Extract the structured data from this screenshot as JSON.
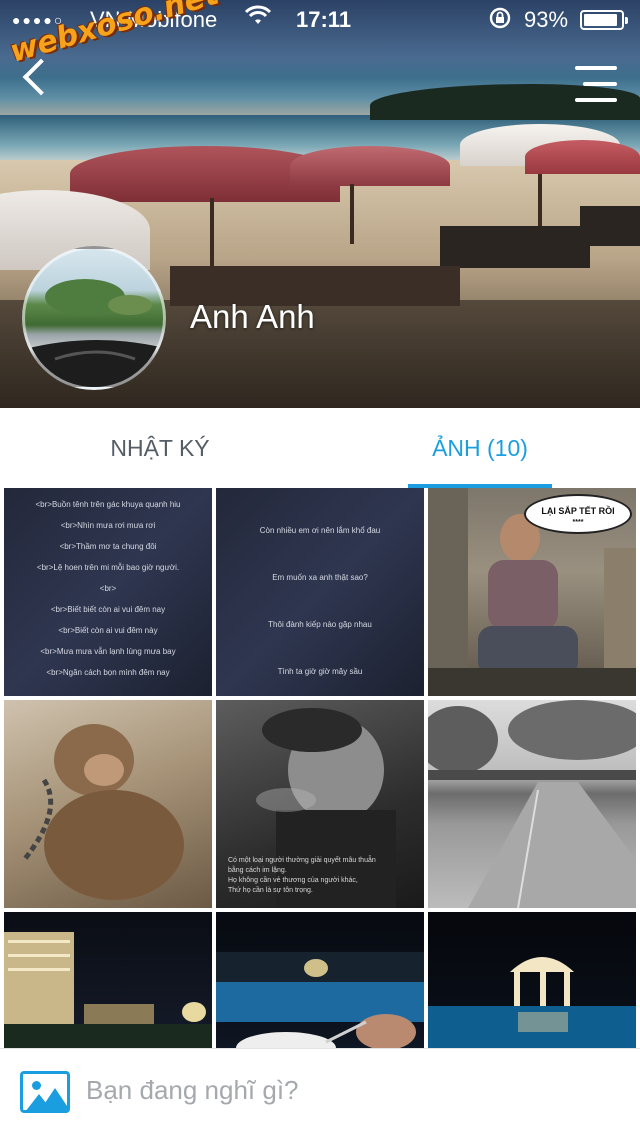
{
  "status_bar": {
    "signal_dots": "●●●●○",
    "carrier": "VN Mobifone",
    "time": "17:11",
    "battery_percent": "93%",
    "battery_level": 0.93,
    "wifi_icon": "wifi-icon",
    "rotation_lock_icon": "rotation-lock-icon"
  },
  "watermark": "webxoso.net",
  "profile": {
    "name": "Anh Anh"
  },
  "tabs": [
    {
      "label": "NHẬT KÝ",
      "active": false
    },
    {
      "label": "ẢNH (10)",
      "active": true
    }
  ],
  "photos": {
    "poem1_lines": [
      "<br>Buồn tênh trên gác khuya quạnh hiu",
      "<br>Nhìn mưa rơi mưa rơi",
      "<br>Thầm mơ ta chung đôi",
      "<br>Lệ hoen trên mi mỗi bao giờ người.",
      "<br>",
      "<br>Biết biết còn ai vui đêm nay",
      "<br>Biết còn ai vui đêm này",
      "<br>Mưa mưa vẫn lạnh lùng mưa bay",
      "<br>Ngăn cách bọn mình đêm nay"
    ],
    "poem2_lines": [
      "Còn nhiều em ơi nên lắm khổ đau",
      "Em muốn xa anh thật sao?",
      "Thôi đành kiếp nào gặp nhau",
      "Tình ta giờ giờ mây sầu"
    ],
    "speech_bubble": "LẠI SẮP TẾT RỒI",
    "speech_bubble_sub": "****",
    "quote_lines": [
      "Có một loại người thường giải quyết mâu thuẫn",
      "bằng cách im lặng.",
      "Họ không cần vẻ thương của người khác,",
      "Thứ họ cần là sự tôn trọng."
    ]
  },
  "composer": {
    "placeholder": "Bạn đang nghĩ gì?",
    "icon": "image-icon"
  },
  "colors": {
    "accent": "#1b9ee0",
    "tab_inactive": "#555d66",
    "placeholder": "#a5a9ae"
  }
}
